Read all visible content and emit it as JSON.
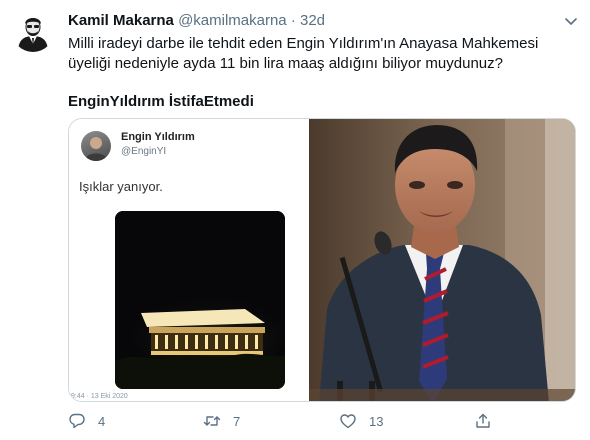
{
  "tweet": {
    "display_name": "Kamil Makarna",
    "handle": "@kamilmakarna",
    "separator": "·",
    "time": "32d",
    "text": "Milli iradeyi darbe ile tehdit eden Engin Yıldırım'ın Anayasa Mahkemesi üyeliği nedeniyle ayda 11 bin lira maaş aldığını biliyor muydunuz?",
    "hashtag": "EnginYıldırım İstifaEtmedi"
  },
  "embedded": {
    "name": "Engin Yıldırım",
    "handle": "@EnginYI",
    "text": "Işıklar yanıyor.",
    "date": "9:44 · 13 Eki 2020"
  },
  "actions": {
    "reply_count": "4",
    "retweet_count": "7",
    "like_count": "13"
  },
  "colors": {
    "text": "#0f1419",
    "secondary": "#5b7083"
  },
  "icons": [
    "avatar-illustration",
    "caret-down-icon",
    "reply-icon",
    "retweet-icon",
    "like-icon",
    "share-icon"
  ]
}
